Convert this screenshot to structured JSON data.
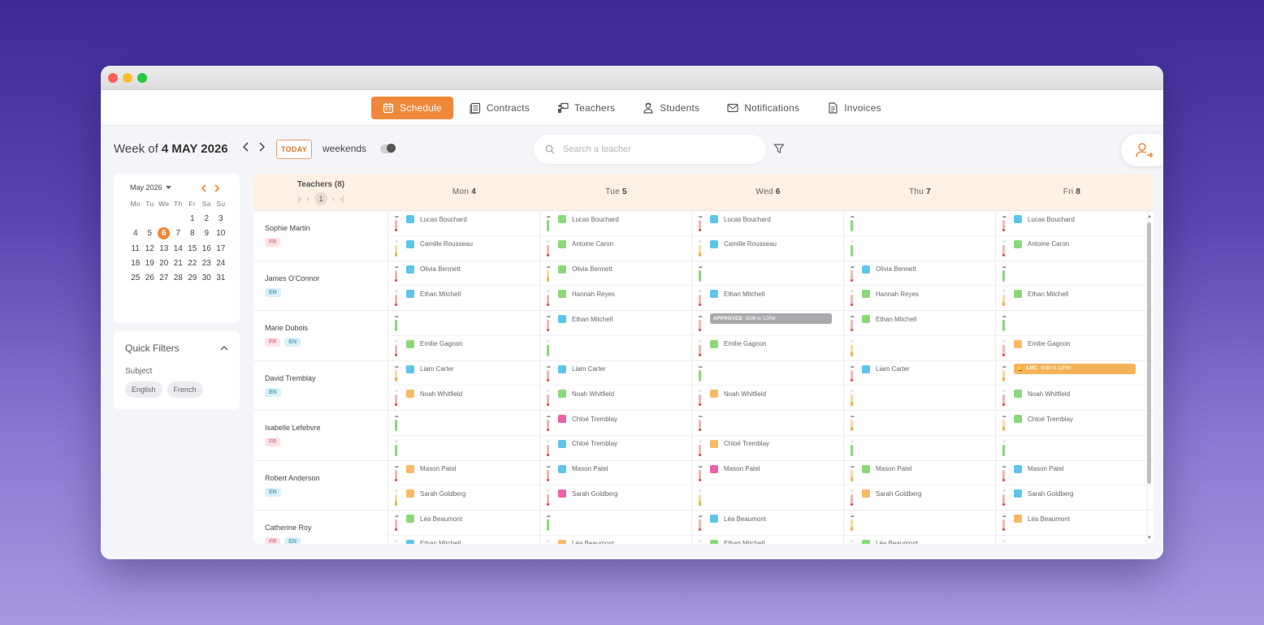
{
  "window": {
    "dots": [
      "#fe5f57",
      "#febc2e",
      "#28c840"
    ]
  },
  "nav": {
    "items": [
      {
        "label": "Schedule",
        "icon": "calendar-icon",
        "active": true
      },
      {
        "label": "Contracts",
        "icon": "document-list-icon",
        "active": false
      },
      {
        "label": "Teachers",
        "icon": "teacher-icon",
        "active": false
      },
      {
        "label": "Students",
        "icon": "student-icon",
        "active": false
      },
      {
        "label": "Notifications",
        "icon": "mail-icon",
        "active": false
      },
      {
        "label": "Invoices",
        "icon": "invoice-icon",
        "active": false
      }
    ]
  },
  "toolbar": {
    "week_prefix": "Week of",
    "week_date": "4 MAY 2026",
    "today_label": "TODAY",
    "weekends_label": "weekends",
    "search_placeholder": "Search a teacher",
    "accent": "#f0883a"
  },
  "calendar": {
    "month_label": "May 2026",
    "dow": [
      "Mo",
      "Tu",
      "We",
      "Th",
      "Fr",
      "Sa",
      "Su"
    ],
    "weeks": [
      [
        "",
        "",
        "",
        "",
        "1",
        "2",
        "3"
      ],
      [
        "4",
        "5",
        "6",
        "7",
        "8",
        "9",
        "10"
      ],
      [
        "11",
        "12",
        "13",
        "14",
        "15",
        "16",
        "17"
      ],
      [
        "18",
        "19",
        "20",
        "21",
        "22",
        "23",
        "24"
      ],
      [
        "25",
        "26",
        "27",
        "28",
        "29",
        "30",
        "31"
      ]
    ],
    "selected": "6"
  },
  "quick_filters": {
    "title": "Quick Filters",
    "subject_label": "Subject",
    "chips": [
      "English",
      "French"
    ]
  },
  "board": {
    "teachers_header": "Teachers (8)",
    "page": "1",
    "days": [
      {
        "dow": "Mon",
        "num": "4"
      },
      {
        "dow": "Tue",
        "num": "5"
      },
      {
        "dow": "Wed",
        "num": "6"
      },
      {
        "dow": "Thu",
        "num": "7"
      },
      {
        "dow": "Fri",
        "num": "8"
      }
    ],
    "teachers": [
      {
        "name": "Sophie Martin",
        "tags": [
          "FR"
        ],
        "slots": [
          [
            {
              "s": "Lucas Bouchard",
              "c": "blue",
              "b": "r"
            },
            {
              "s": "Camille Rousseau",
              "c": "blue",
              "b": "y"
            }
          ],
          [
            {
              "s": "Lucas Bouchard",
              "c": "green",
              "b": "g"
            },
            {
              "s": "Antoine Caron",
              "c": "green",
              "b": "r"
            }
          ],
          [
            {
              "s": "Lucas Bouchard",
              "c": "blue",
              "b": "r"
            },
            {
              "s": "Camille Rousseau",
              "c": "blue",
              "b": "y"
            }
          ],
          [
            {
              "s": "",
              "c": "",
              "b": "g"
            },
            {
              "s": "",
              "c": "",
              "b": "g"
            }
          ],
          [
            {
              "s": "Lucas Bouchard",
              "c": "blue",
              "b": "r"
            },
            {
              "s": "Antoine Caron",
              "c": "green",
              "b": "r"
            }
          ]
        ]
      },
      {
        "name": "James O'Connor",
        "tags": [
          "EN"
        ],
        "slots": [
          [
            {
              "s": "Olivia Bennett",
              "c": "blue",
              "b": "r"
            },
            {
              "s": "Ethan Mitchell",
              "c": "blue",
              "b": "r"
            }
          ],
          [
            {
              "s": "Olivia Bennett",
              "c": "green",
              "b": "y"
            },
            {
              "s": "Hannah Reyes",
              "c": "green",
              "b": "r"
            }
          ],
          [
            {
              "s": "",
              "c": "",
              "b": "g"
            },
            {
              "s": "Ethan Mitchell",
              "c": "blue",
              "b": "r"
            }
          ],
          [
            {
              "s": "Olivia Bennett",
              "c": "blue",
              "b": "r"
            },
            {
              "s": "Hannah Reyes",
              "c": "green",
              "b": "r"
            }
          ],
          [
            {
              "s": "",
              "c": "",
              "b": "g"
            },
            {
              "s": "Ethan Mitchell",
              "c": "green",
              "b": "y"
            }
          ]
        ]
      },
      {
        "name": "Marie Dubois",
        "tags": [
          "FR",
          "EN"
        ],
        "slots": [
          [
            {
              "s": "",
              "c": "",
              "b": "g"
            },
            {
              "s": "Emilie Gagnon",
              "c": "green",
              "b": "r"
            }
          ],
          [
            {
              "s": "Ethan Mitchell",
              "c": "blue",
              "b": "r"
            },
            {
              "s": "",
              "c": "",
              "b": "g"
            }
          ],
          [
            {
              "pill": "APPROVED",
              "time": "9AM to 12PM",
              "pc": "gray",
              "b": "r"
            },
            {
              "s": "Emilie Gagnon",
              "c": "green",
              "b": "r"
            }
          ],
          [
            {
              "s": "Ethan Mitchell",
              "c": "green",
              "b": "r"
            },
            {
              "s": "",
              "c": "",
              "b": "y"
            }
          ],
          [
            {
              "s": "",
              "c": "",
              "b": "g"
            },
            {
              "s": "Emilie Gagnon",
              "c": "orange",
              "b": "r"
            }
          ]
        ]
      },
      {
        "name": "David Tremblay",
        "tags": [
          "EN"
        ],
        "slots": [
          [
            {
              "s": "Liam Carter",
              "c": "blue",
              "b": "y"
            },
            {
              "s": "Noah Whitfield",
              "c": "orange",
              "b": "r"
            }
          ],
          [
            {
              "s": "Liam Carter",
              "c": "blue",
              "b": "r"
            },
            {
              "s": "Noah Whitfield",
              "c": "green",
              "b": "r"
            }
          ],
          [
            {
              "s": "",
              "c": "",
              "b": "g"
            },
            {
              "s": "Noah Whitfield",
              "c": "orange",
              "b": "r"
            }
          ],
          [
            {
              "s": "Liam Carter",
              "c": "blue",
              "b": "r"
            },
            {
              "s": "",
              "c": "",
              "b": "y"
            }
          ],
          [
            {
              "pill": "LMC",
              "time": "9AM to 12PM",
              "pc": "orange",
              "b": "y"
            },
            {
              "s": "Noah Whitfield",
              "c": "green",
              "b": "r"
            }
          ]
        ]
      },
      {
        "name": "Isabelle Lefebvre",
        "tags": [
          "FR"
        ],
        "slots": [
          [
            {
              "s": "",
              "c": "",
              "b": "g"
            },
            {
              "s": "",
              "c": "",
              "b": "g"
            }
          ],
          [
            {
              "s": "Chloé Tremblay",
              "c": "pink",
              "b": "r"
            },
            {
              "s": "Chloé Tremblay",
              "c": "blue",
              "b": "r"
            }
          ],
          [
            {
              "s": "",
              "c": "",
              "b": "r"
            },
            {
              "s": "Chloé Tremblay",
              "c": "orange",
              "b": "r"
            }
          ],
          [
            {
              "s": "",
              "c": "",
              "b": "y"
            },
            {
              "s": "",
              "c": "",
              "b": "g"
            }
          ],
          [
            {
              "s": "Chloé Tremblay",
              "c": "green",
              "b": "y"
            },
            {
              "s": "",
              "c": "",
              "b": "g"
            }
          ]
        ]
      },
      {
        "name": "Robert Anderson",
        "tags": [
          "EN"
        ],
        "slots": [
          [
            {
              "s": "Mason Patel",
              "c": "orange",
              "b": "r"
            },
            {
              "s": "Sarah Goldberg",
              "c": "orange",
              "b": "y"
            }
          ],
          [
            {
              "s": "Mason Patel",
              "c": "blue",
              "b": "r"
            },
            {
              "s": "Sarah Goldberg",
              "c": "pink",
              "b": "r"
            }
          ],
          [
            {
              "s": "Mason Patel",
              "c": "pink",
              "b": "r"
            },
            {
              "s": "",
              "c": "",
              "b": "y"
            }
          ],
          [
            {
              "s": "Mason Patel",
              "c": "green",
              "b": "y"
            },
            {
              "s": "Sarah Goldberg",
              "c": "orange",
              "b": "r"
            }
          ],
          [
            {
              "s": "Mason Patel",
              "c": "blue",
              "b": "r"
            },
            {
              "s": "Sarah Goldberg",
              "c": "blue",
              "b": "r"
            }
          ]
        ]
      },
      {
        "name": "Catherine Roy",
        "tags": [
          "FR",
          "EN"
        ],
        "slots": [
          [
            {
              "s": "Léa Beaumont",
              "c": "green",
              "b": "r"
            },
            {
              "s": "Ethan Mitchell",
              "c": "blue",
              "b": "g"
            }
          ],
          [
            {
              "s": "",
              "c": "",
              "b": "g"
            },
            {
              "s": "Léa Beaumont",
              "c": "orange",
              "b": "r"
            }
          ],
          [
            {
              "s": "Léa Beaumont",
              "c": "blue",
              "b": "r"
            },
            {
              "s": "Ethan Mitchell",
              "c": "green",
              "b": "r"
            }
          ],
          [
            {
              "s": "",
              "c": "",
              "b": "y"
            },
            {
              "s": "Léa Beaumont",
              "c": "green",
              "b": "g"
            }
          ],
          [
            {
              "s": "Léa Beaumont",
              "c": "orange",
              "b": "r"
            },
            {
              "s": "",
              "c": "",
              "b": "g"
            }
          ]
        ]
      }
    ]
  }
}
